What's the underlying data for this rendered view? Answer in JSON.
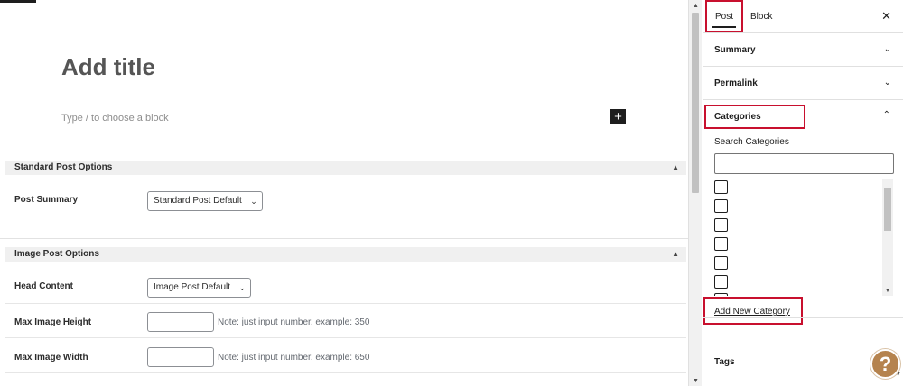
{
  "editor": {
    "title_placeholder": "Add title",
    "block_hint": "Type / to choose a block",
    "inserter_icon": "plus-icon",
    "inserter_symbol": "+"
  },
  "standard_post_options": {
    "heading": "Standard Post Options",
    "post_summary_label": "Post Summary",
    "post_summary_value": "Standard Post Default"
  },
  "image_post_options": {
    "heading": "Image Post Options",
    "head_content_label": "Head Content",
    "head_content_value": "Image Post Default",
    "max_height_label": "Max Image Height",
    "max_height_value": "",
    "max_height_note": "Note: just input number. example: 350",
    "max_width_label": "Max Image Width",
    "max_width_value": "",
    "max_width_note": "Note: just input number. example: 650"
  },
  "sidebar": {
    "tabs": [
      {
        "label": "Post",
        "active": true
      },
      {
        "label": "Block",
        "active": false
      }
    ],
    "close_symbol": "✕",
    "panels": {
      "summary": "Summary",
      "permalink": "Permalink",
      "categories": "Categories",
      "tags": "Tags"
    },
    "search_categories_label": "Search Categories",
    "search_categories_value": "",
    "category_checkbox_count": 7,
    "add_new_category": "Add New Category"
  },
  "help_symbol": "?",
  "colors": {
    "highlight_red": "#c8102e",
    "help_button": "#b5834e"
  }
}
